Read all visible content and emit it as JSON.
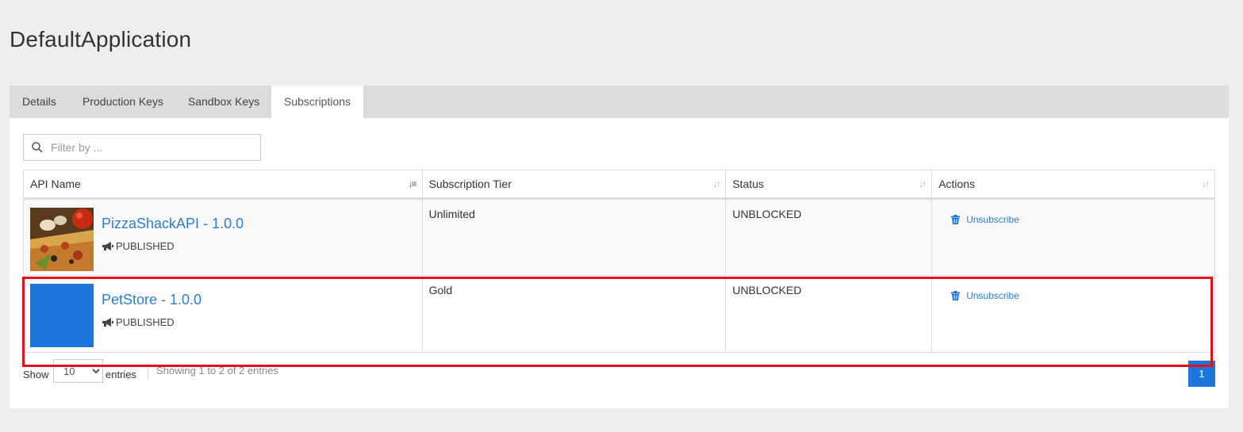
{
  "app": {
    "title": "DefaultApplication"
  },
  "tabs": [
    {
      "label": "Details"
    },
    {
      "label": "Production Keys"
    },
    {
      "label": "Sandbox Keys"
    },
    {
      "label": "Subscriptions"
    }
  ],
  "filter": {
    "placeholder": "Filter by ...",
    "value": ""
  },
  "table": {
    "columns": [
      "API Name",
      "Subscription Tier",
      "Status",
      "Actions"
    ],
    "rows": [
      {
        "api_name": "PizzaShackAPI - 1.0.0",
        "lifecycle": "PUBLISHED",
        "tier": "Unlimited",
        "status": "UNBLOCKED",
        "action": "Unsubscribe",
        "thumbnail": "pizza-image"
      },
      {
        "api_name": "PetStore - 1.0.0",
        "lifecycle": "PUBLISHED",
        "tier": "Gold",
        "status": "UNBLOCKED",
        "action": "Unsubscribe",
        "thumbnail": "blue-placeholder"
      }
    ]
  },
  "footer": {
    "show_label": "Show",
    "page_size": "10",
    "entries_label": "entries",
    "info": "Showing 1 to 2 of 2 entries",
    "current_page": "1"
  },
  "colors": {
    "accent": "#1d76d9",
    "link": "#2b7ed8",
    "highlight": "#e3111b",
    "tabbar": "#dcdcdc"
  }
}
